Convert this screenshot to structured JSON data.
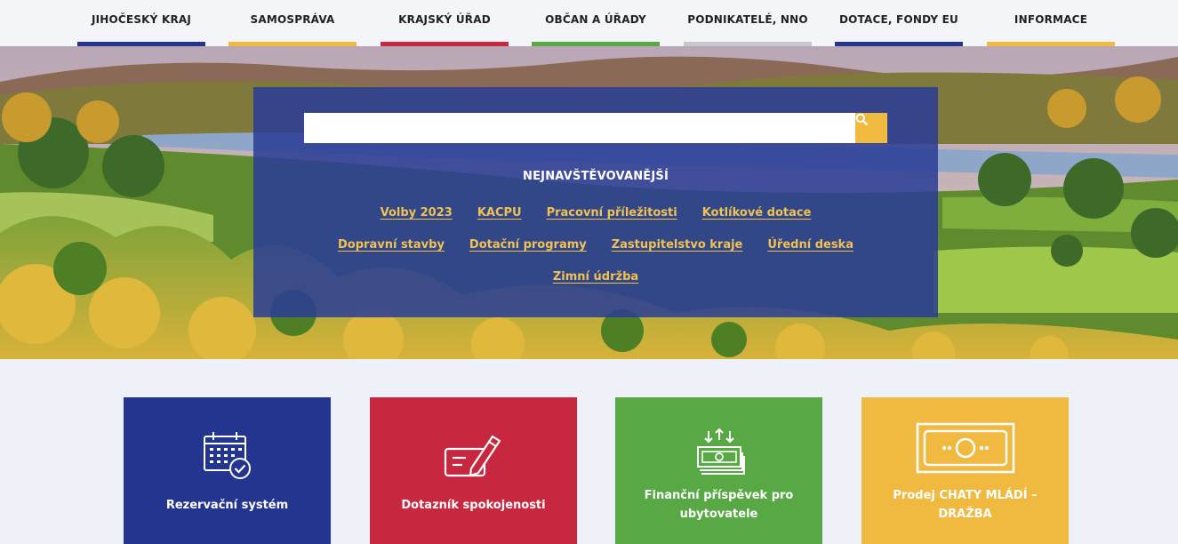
{
  "nav": {
    "items": [
      {
        "label": "JIHOČESKÝ KRAJ",
        "color": "#24358f"
      },
      {
        "label": "SAMOSPRÁVA",
        "color": "#f0b940"
      },
      {
        "label": "KRAJSKÝ ÚŘAD",
        "color": "#c8283f"
      },
      {
        "label": "OBČAN A ÚŘADY",
        "color": "#58a845"
      },
      {
        "label": "PODNIKATELÉ, NNO",
        "color": "#c6c8cc"
      },
      {
        "label": "DOTACE, FONDY EU",
        "color": "#24358f"
      },
      {
        "label": "INFORMACE",
        "color": "#f0b940"
      }
    ]
  },
  "search": {
    "value": "",
    "button_icon": "search-icon"
  },
  "popular": {
    "heading": "NEJNAVŠTĚVOVANĚJŠÍ",
    "links": [
      "Volby 2023",
      "KACPU",
      "Pracovní příležitosti",
      "Kotlíkové dotace",
      "Dopravní stavby",
      "Dotační programy",
      "Zastupitelstvo kraje",
      "Úřední deska",
      "Zimní údržba"
    ],
    "link_color": "#f2c14e",
    "panel_color": "#2a3c96"
  },
  "tiles": [
    {
      "label": "Rezervační systém",
      "icon": "calendar-check-icon",
      "color": "#24358f"
    },
    {
      "label": "Dotazník spokojenosti",
      "icon": "form-pen-icon",
      "color": "#c8283f"
    },
    {
      "label": "Finanční příspěvek pro ubytovatele",
      "icon": "money-transfer-icon",
      "color": "#58a845"
    },
    {
      "label": "Prodej CHATY MLÁDÍ – DRAŽBA",
      "icon": "banknote-icon",
      "color": "#f0b940"
    }
  ]
}
